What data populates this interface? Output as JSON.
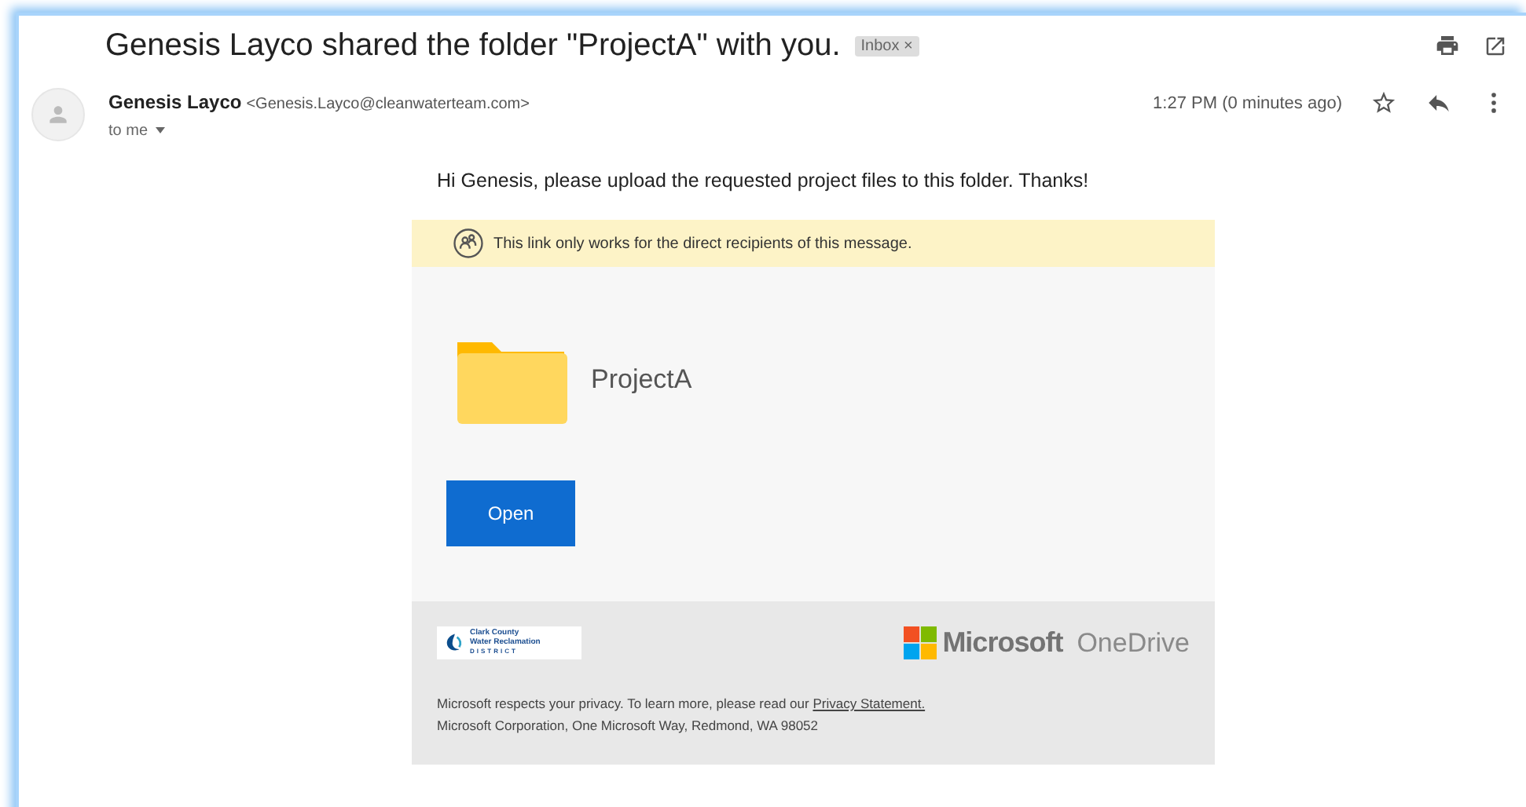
{
  "email": {
    "subject": "Genesis Layco shared the folder \"ProjectA\" with you.",
    "label": {
      "text": "Inbox",
      "close": "×"
    },
    "sender": {
      "name": "Genesis Layco",
      "address": "<Genesis.Layco@cleanwaterteam.com>",
      "recipient": "to me"
    },
    "time": "1:27 PM (0 minutes ago)",
    "starred": false
  },
  "message": {
    "greeting": "Hi Genesis, please upload the requested project files to this folder. Thanks!",
    "notice": "This link only works for the direct recipients of this message.",
    "folder": "ProjectA",
    "button": "Open",
    "footer": {
      "org_logo": [
        "Clark County",
        "Water Reclamation",
        "DISTRICT"
      ],
      "brand": "Microsoft",
      "product": "OneDrive",
      "privacy": "Microsoft respects your privacy. To learn more, please read our",
      "privacy_link": "Privacy Statement.",
      "address": "Microsoft Corporation, One Microsoft Way, Redmond, WA 98052"
    }
  }
}
